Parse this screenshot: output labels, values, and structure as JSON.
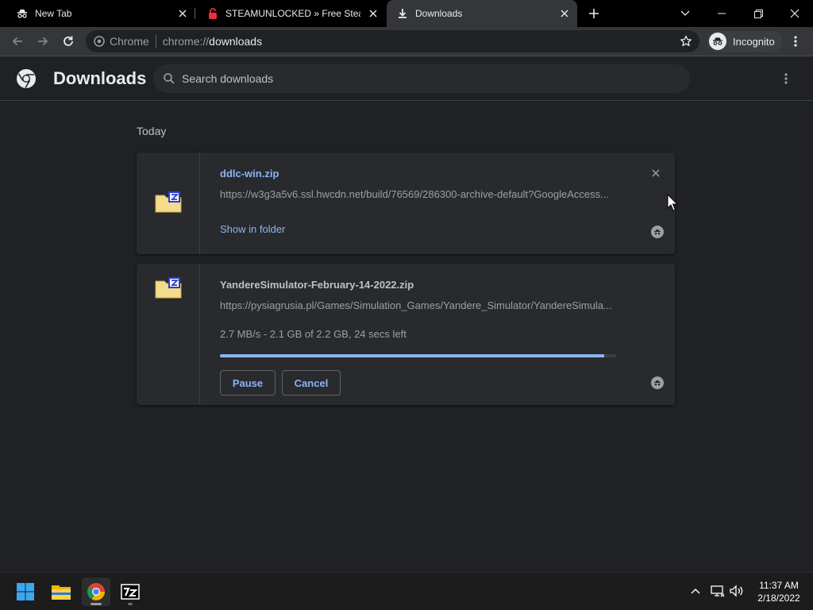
{
  "tabs": [
    {
      "title": "New Tab",
      "icon": "incognito-icon",
      "active": false
    },
    {
      "title": "STEAMUNLOCKED » Free Steam",
      "icon": "steamunlocked-favicon",
      "active": false
    },
    {
      "title": "Downloads",
      "icon": "download-icon",
      "active": true
    }
  ],
  "toolbar": {
    "site_label": "Chrome",
    "url_scheme": "chrome://",
    "url_host": "downloads",
    "profile_label": "Incognito"
  },
  "page": {
    "title": "Downloads",
    "search_placeholder": "Search downloads"
  },
  "section": "Today",
  "downloads": [
    {
      "filename": "ddlc-win.zip",
      "url": "https://w3g3a5v6.ssl.hwcdn.net/build/76569/286300-archive-default?GoogleAccess...",
      "action_label": "Show in folder",
      "state": "complete"
    },
    {
      "filename": "YandereSimulator-February-14-2022.zip",
      "url": "https://pysiagrusia.pl/Games/Simulation_Games/Yandere_Simulator/YandereSimula...",
      "status": "2.7 MB/s - 2.1 GB of 2.2 GB, 24 secs left",
      "progress": 0.97,
      "pause_label": "Pause",
      "cancel_label": "Cancel",
      "state": "in_progress"
    }
  ],
  "taskbar": {
    "apps": [
      "windows-start-icon",
      "file-explorer-icon",
      "chrome-icon",
      "7zip-icon"
    ],
    "time": "11:37 AM",
    "date": "2/18/2022"
  },
  "colors": {
    "accent": "#8ab4f8",
    "background": "#202124",
    "card": "#292a2d",
    "steam_red": "#e8303c"
  }
}
